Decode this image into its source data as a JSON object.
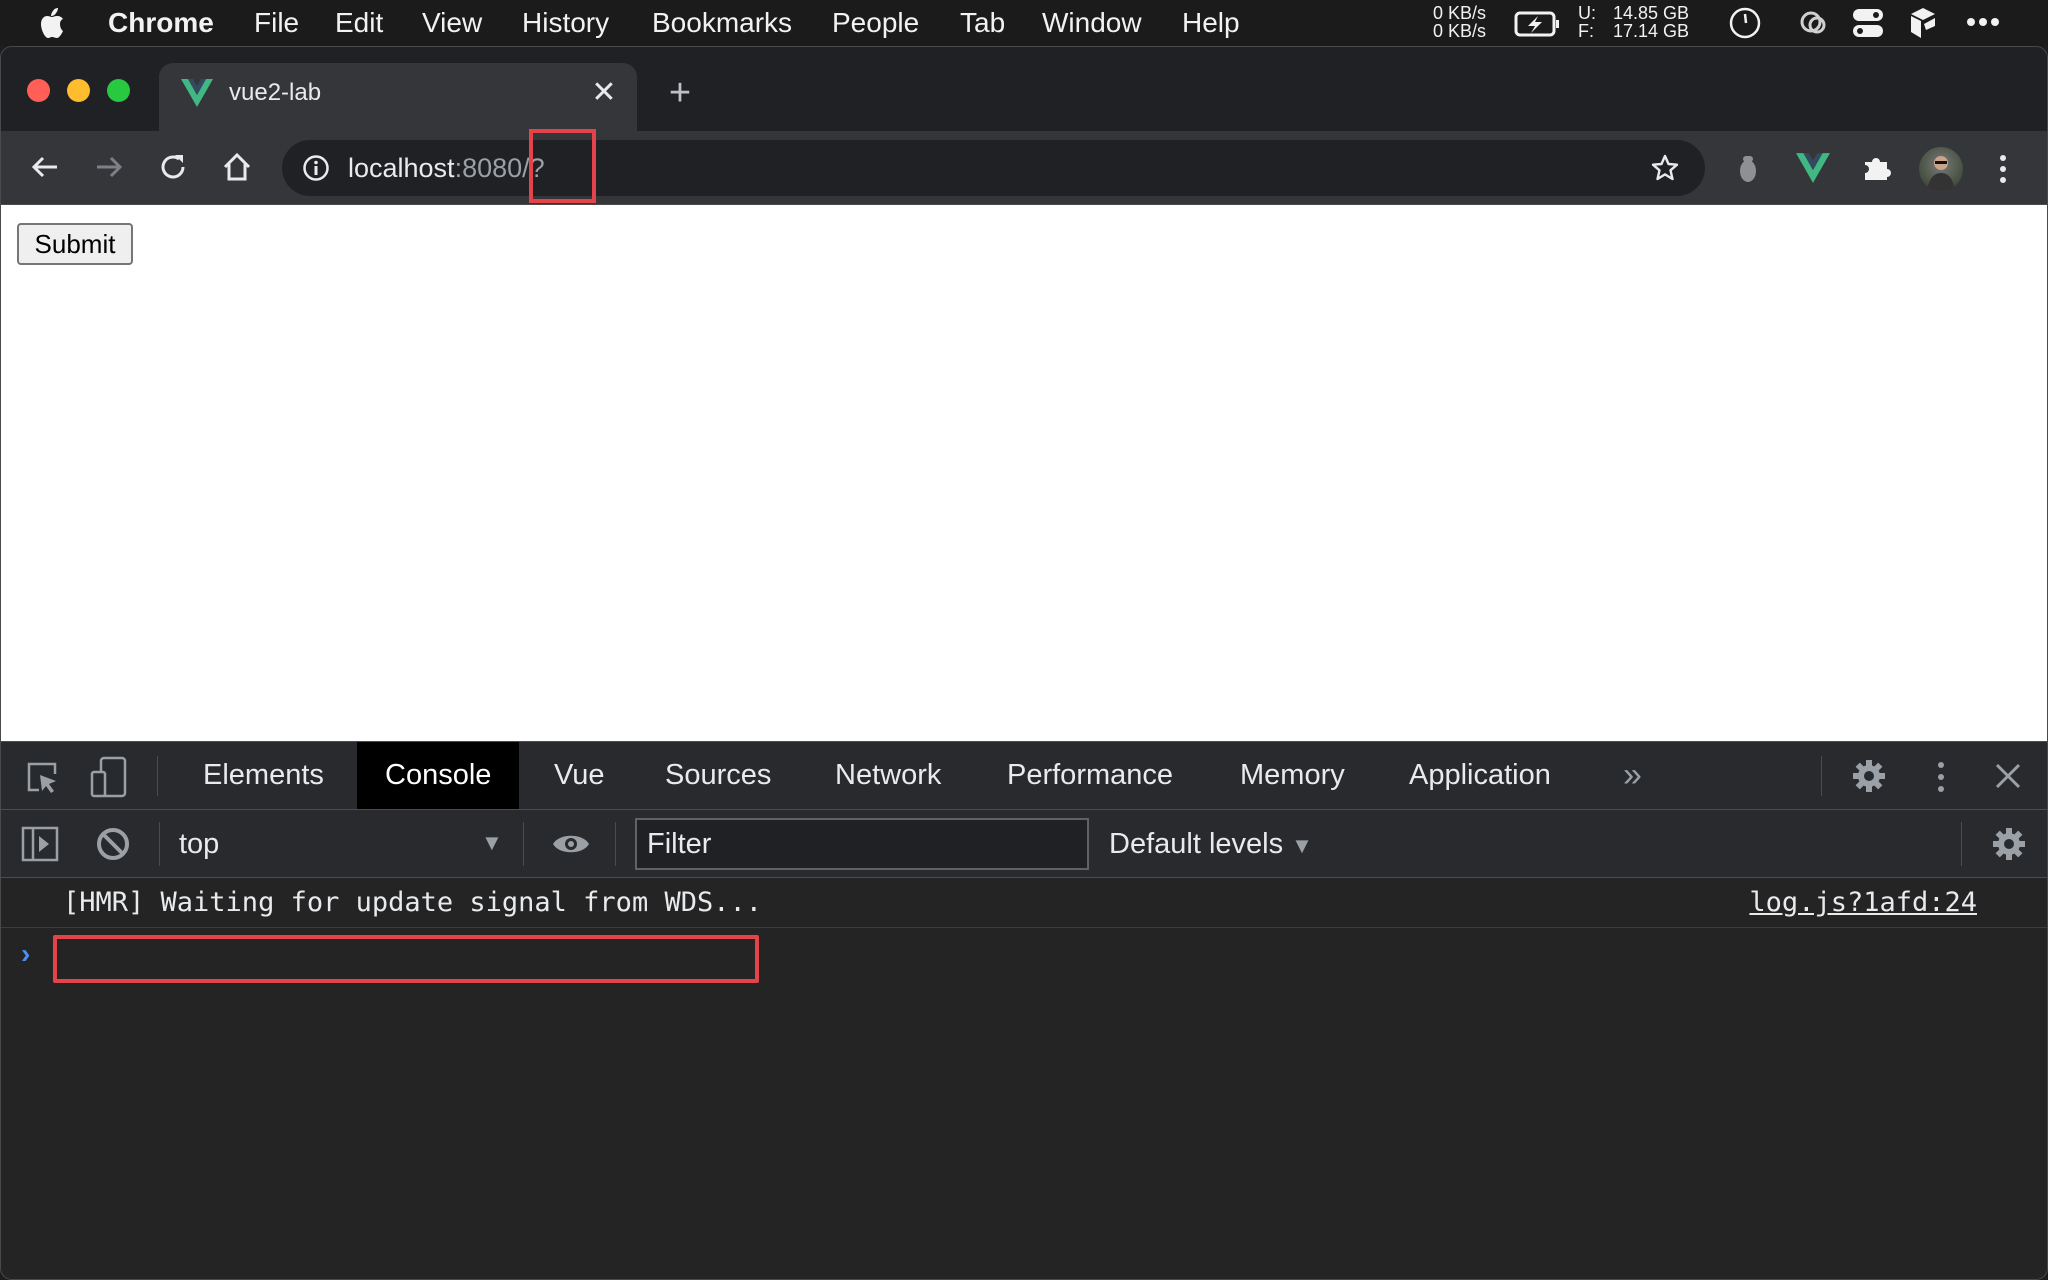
{
  "menubar": {
    "app": "Chrome",
    "items": [
      "File",
      "Edit",
      "View",
      "History",
      "Bookmarks",
      "People",
      "Tab",
      "Window",
      "Help"
    ],
    "status": {
      "net_up": "0 KB/s",
      "net_down": "0 KB/s",
      "disk_used_label": "U:",
      "disk_used": "14.85 GB",
      "disk_free_label": "F:",
      "disk_free": "17.14 GB"
    }
  },
  "browser": {
    "tab_title": "vue2-lab",
    "tab_close": "✕",
    "new_tab": "+",
    "url_host": "localhost",
    "url_port": ":8080",
    "url_path": "/?"
  },
  "page": {
    "submit_label": "Submit"
  },
  "devtools": {
    "tabs": [
      "Elements",
      "Console",
      "Vue",
      "Sources",
      "Network",
      "Performance",
      "Memory",
      "Application"
    ],
    "active_tab": "Console",
    "more_tabs": "»",
    "context": "top",
    "filter_placeholder": "Filter",
    "levels": "Default levels",
    "log": {
      "message": "[HMR] Waiting for update signal from WDS...",
      "source": "log.js?1afd:24"
    },
    "prompt": "›",
    "console_input_value": ""
  },
  "colors": {
    "highlight": "#e5434a",
    "vue_green": "#41b883",
    "vue_dark": "#34495e"
  }
}
